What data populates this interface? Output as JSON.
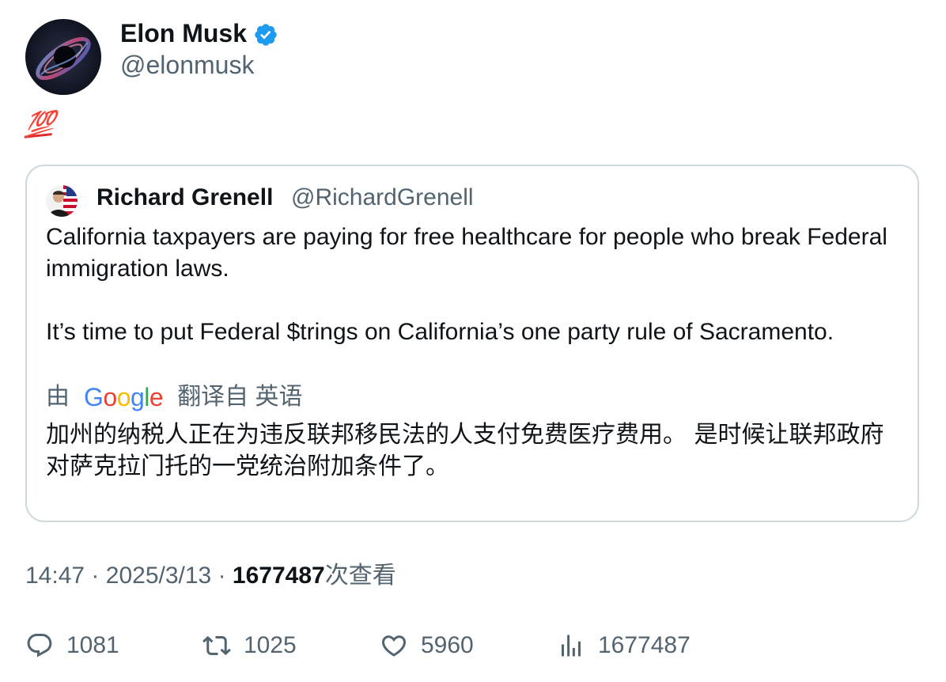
{
  "tweet": {
    "author": {
      "name": "Elon Musk",
      "handle": "@elonmusk",
      "verified": true,
      "verified_color": "#1d9bf0"
    },
    "text_emoji": "💯",
    "quoted": {
      "author_name": "Richard Grenell",
      "author_handle": "@RichardGrenell",
      "paragraphs": [
        "California taxpayers are paying for free healthcare for people who break Federal immigration laws.",
        "It’s time to put Federal $trings on California’s one party rule of Sacramento."
      ],
      "translation_prefix": "由",
      "translation_provider": "Google",
      "translation_suffix": "翻译自 英语",
      "translation": "加州的纳税人正在为违反联邦移民法的人支付免费医疗费用。 是时候让联邦政府对萨克拉门托的一党统治附加条件了。"
    },
    "meta": {
      "time": "14:47",
      "separator": "·",
      "date": "2025/3/13",
      "views": "1677487",
      "views_label": "次查看"
    },
    "actions": {
      "reply_count": "1081",
      "retweet_count": "1025",
      "like_count": "5960",
      "views_count": "1677487"
    },
    "icons": {
      "reply": "reply-bubble-icon",
      "retweet": "retweet-icon",
      "like": "heart-icon",
      "views": "bar-chart-icon",
      "verified": "verified-badge-icon"
    },
    "colors": {
      "text_primary": "#0f1419",
      "text_secondary": "#536471",
      "border": "#cfd9de",
      "accent": "#1d9bf0"
    }
  }
}
